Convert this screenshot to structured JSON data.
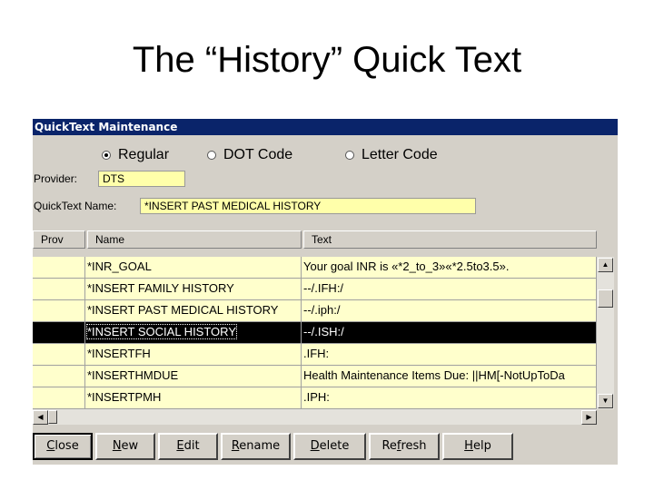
{
  "slide_title": "The “History” Quick Text",
  "window_title": "QuickText Maintenance",
  "radios": [
    {
      "label": "Regular",
      "selected": true
    },
    {
      "label": "DOT Code",
      "selected": false
    },
    {
      "label": "Letter Code",
      "selected": false
    }
  ],
  "provider_label": "Provider:",
  "provider_value": "DTS",
  "qt_name_label": "QuickText Name:",
  "qt_name_value": "*INSERT PAST MEDICAL HISTORY",
  "columns": {
    "prov": "Prov",
    "name": "Name",
    "text": "Text"
  },
  "rows": [
    {
      "prov": "",
      "name": "*INR_GOAL",
      "text": "Your goal INR is «*2_to_3»«*2.5to3.5».",
      "selected": false
    },
    {
      "prov": "",
      "name": "*INSERT FAMILY HISTORY",
      "text": "--/.IFH:/",
      "selected": false
    },
    {
      "prov": "",
      "name": "*INSERT PAST MEDICAL HISTORY",
      "text": "--/.iph:/",
      "selected": false
    },
    {
      "prov": "",
      "name": "*INSERT SOCIAL HISTORY",
      "text": "--/.ISH:/",
      "selected": true
    },
    {
      "prov": "",
      "name": "*INSERTFH",
      "text": ".IFH:",
      "selected": false
    },
    {
      "prov": "",
      "name": "*INSERTHMDUE",
      "text": "Health Maintenance Items Due: ||HM[-NotUpToDa",
      "selected": false
    },
    {
      "prov": "",
      "name": "*INSERTPMH",
      "text": ".IPH:",
      "selected": false
    }
  ],
  "buttons": {
    "close": {
      "pre": "",
      "u": "C",
      "post": "lose"
    },
    "new": {
      "pre": "",
      "u": "N",
      "post": "ew"
    },
    "edit": {
      "pre": "",
      "u": "E",
      "post": "dit"
    },
    "rename": {
      "pre": "",
      "u": "R",
      "post": "ename"
    },
    "delete": {
      "pre": "",
      "u": "D",
      "post": "elete"
    },
    "refresh": {
      "pre": "Re",
      "u": "f",
      "post": "resh"
    },
    "help": {
      "pre": "",
      "u": "H",
      "post": "elp"
    }
  },
  "icons": {
    "scroll_up": "▲",
    "scroll_down": "▼",
    "scroll_left": "◀",
    "scroll_right": "▶"
  }
}
